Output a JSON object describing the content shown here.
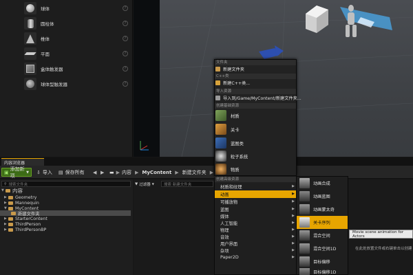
{
  "place_panel": {
    "items": [
      {
        "label": "球体",
        "icon": "sphere-icon"
      },
      {
        "label": "圆柱体",
        "icon": "cylinder-icon"
      },
      {
        "label": "椎体",
        "icon": "cone-icon"
      },
      {
        "label": "平面",
        "icon": "plane-icon"
      },
      {
        "label": "盒体触发器",
        "icon": "box-trigger-icon"
      },
      {
        "label": "球体型触发器",
        "icon": "sphere-trigger-icon"
      }
    ],
    "help_glyph": "?"
  },
  "content_browser": {
    "tab_label": "内容浏览器",
    "toolbar": {
      "add_new": "添加新项",
      "import": "导入",
      "save_all": "保存所有"
    },
    "breadcrumb": [
      "内容",
      "MyContent",
      "新建文件夹"
    ],
    "search_folders_placeholder": "搜索文件夹",
    "filters_label": "过滤器",
    "search_assets_placeholder": "搜索 新建文件夹",
    "tree": {
      "root": "内容",
      "items": [
        {
          "label": "Geometry",
          "level": 1
        },
        {
          "label": "Mannequin",
          "level": 1
        },
        {
          "label": "MyContent",
          "level": 1
        },
        {
          "label": "新建文件夹",
          "level": 2,
          "selected": true
        },
        {
          "label": "StarterContent",
          "level": 1
        },
        {
          "label": "ThirdPerson",
          "level": 1
        },
        {
          "label": "ThirdPersonBP",
          "level": 1
        }
      ]
    },
    "drop_hint": "在此处放置文件或右键单击以创建"
  },
  "context_menu": {
    "sec_folder": "文件夹",
    "new_folder": "新建文件夹",
    "sec_cpp": "C++类",
    "new_cpp": "新建C++类...",
    "sec_import": "导入资源",
    "import_to": "导入到/Game/MyContent/新建文件夹...",
    "sec_basic": "创建基础资源",
    "basic_assets": [
      "材质",
      "关卡",
      "蓝图类",
      "粒子系统",
      "物质"
    ],
    "sec_advanced": "创建高级资源",
    "advanced": [
      "材质和纹理",
      "动画",
      "可播放物",
      "蓝图",
      "媒体",
      "人工智能",
      "物理",
      "音效",
      "用户界面",
      "杂项",
      "Paper2D"
    ]
  },
  "anim_submenu": {
    "items": [
      "动画合成",
      "动画蓝图",
      "动画蒙太奇",
      "关卡序列",
      "混合空间",
      "混合空间1D",
      "目标偏移",
      "目标偏移1D"
    ]
  },
  "tooltip": "Movie scene animation for Actors",
  "colors": {
    "accent": "#e7a500",
    "add_new_green": "#3c6b16",
    "folder": "#c99a4b"
  }
}
